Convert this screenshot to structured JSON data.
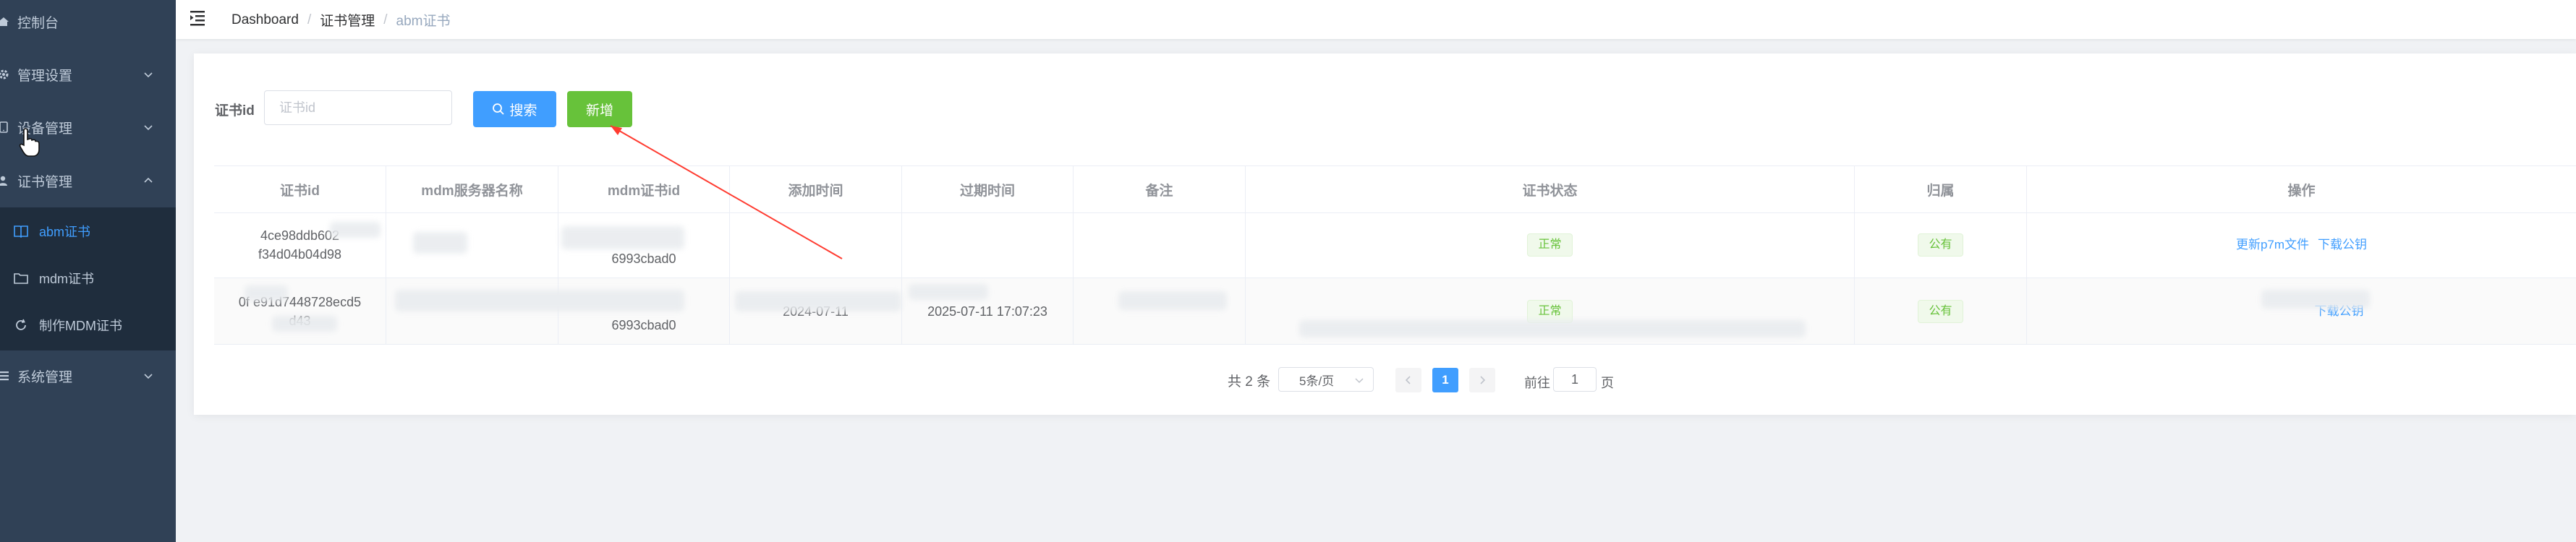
{
  "sidebar": {
    "items": [
      {
        "label": "控制台",
        "icon": "home-icon"
      },
      {
        "label": "管理设置",
        "icon": "gear-icon"
      },
      {
        "label": "设备管理",
        "icon": "tablet-icon"
      },
      {
        "label": "证书管理",
        "icon": "user-icon"
      }
    ],
    "cert_sub": [
      {
        "label": "abm证书",
        "icon": "book-icon",
        "active": true
      },
      {
        "label": "mdm证书",
        "icon": "folder-icon"
      },
      {
        "label": "制作MDM证书",
        "icon": "refresh-icon"
      }
    ],
    "system": {
      "label": "系统管理",
      "icon": "list-icon"
    }
  },
  "navbar": {
    "breadcrumb": [
      "Dashboard",
      "证书管理",
      "abm证书"
    ],
    "separator": "/"
  },
  "search": {
    "label": "证书id",
    "placeholder": "证书id",
    "search_btn": "搜索",
    "add_btn": "新增"
  },
  "table": {
    "headers": [
      "证书id",
      "mdm服务器名称",
      "mdm证书id",
      "添加时间",
      "过期时间",
      "备注",
      "证书状态",
      "归属",
      "操作"
    ],
    "rows": [
      {
        "cert_id_line1": "4ce98ddb602",
        "cert_id_line2": "f34d04b04d98",
        "mdm_id": "6993cbad0",
        "status": "正常",
        "owner": "公有",
        "action1": "更新p7m文件",
        "action2": "下载公钥"
      },
      {
        "cert_id_line1": "0f",
        "cert_id_line1b": "e91d7448728ecd5",
        "cert_id_line2": "d43",
        "mdm_id": "6993cbad0",
        "added": "2024-07-11",
        "expires": "2025-07-11 17:07:23",
        "status": "正常",
        "owner": "公有",
        "action2": "下载公钥"
      }
    ]
  },
  "pagination": {
    "total": "共 2 条",
    "page_size": "5条/页",
    "current": "1",
    "goto_label": "前往",
    "goto_value": "1",
    "page_suffix": "页"
  },
  "colors": {
    "sidebar_bg": "#304156",
    "submenu_bg": "#1f2d3d",
    "primary": "#409eff",
    "success": "#67c23a",
    "annotation": "#ff3b30"
  }
}
